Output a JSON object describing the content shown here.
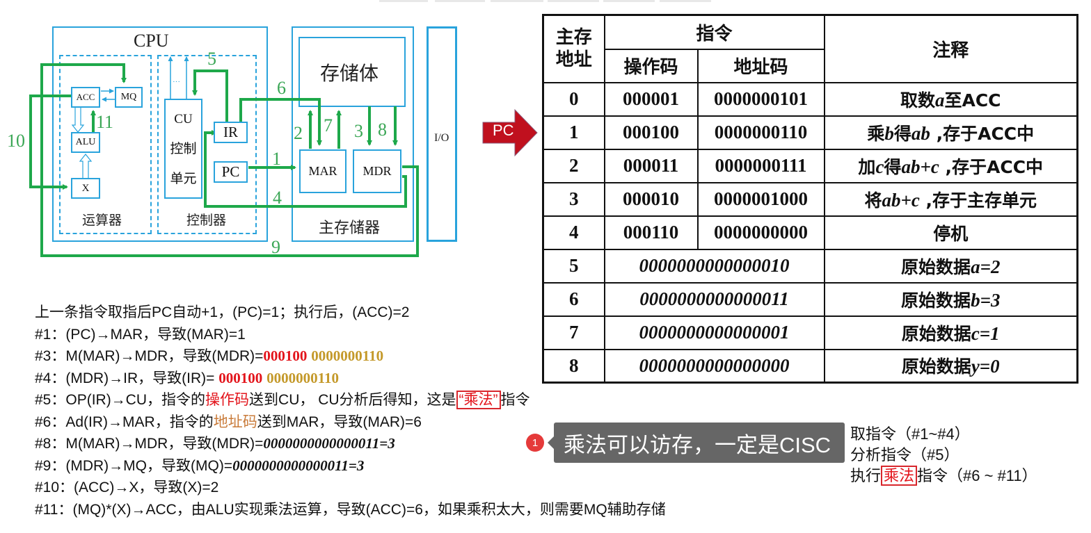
{
  "diagram": {
    "cpu_label": "CPU",
    "alu_group_label": "运算器",
    "cu_group_label": "控制器",
    "memory_label": "主存储器",
    "storage_body_label": "存储体",
    "io_label": "I/O",
    "registers": {
      "acc": "ACC",
      "mq": "MQ",
      "alu": "ALU",
      "x": "X",
      "cu_line1": "CU",
      "cu_line2": "控制",
      "cu_line3": "单元",
      "ir": "IR",
      "pc": "PC",
      "mar": "MAR",
      "mdr": "MDR",
      "cu_dots": "···"
    },
    "step_numbers": [
      "1",
      "2",
      "3",
      "4",
      "5",
      "6",
      "7",
      "8",
      "9",
      "10",
      "11"
    ],
    "colors": {
      "bus": "#1ea84a",
      "block": "#29a3dc"
    }
  },
  "pc_pointer": {
    "label": "PC",
    "color": "#c0101e",
    "points_to_address": "1"
  },
  "memory_table": {
    "headers": {
      "address": "主存地址",
      "address_line1": "主存",
      "address_line2": "地址",
      "instruction": "指令",
      "opcode": "操作码",
      "addr_code": "地址码",
      "comment": "注释"
    },
    "rows": [
      {
        "address": "0",
        "opcode": "000001",
        "addr_code": "0000000101",
        "comment_parts": [
          "取数",
          "a",
          "至ACC"
        ]
      },
      {
        "address": "1",
        "opcode": "000100",
        "addr_code": "0000000110",
        "comment_parts": [
          "乘",
          "b",
          "得",
          "ab",
          " ,存于ACC中"
        ]
      },
      {
        "address": "2",
        "opcode": "000011",
        "addr_code": "0000000111",
        "comment_parts": [
          "加",
          "c",
          "得",
          "ab+c",
          "  ,存于ACC中"
        ]
      },
      {
        "address": "3",
        "opcode": "000010",
        "addr_code": "0000001000",
        "comment_parts": [
          "将",
          "ab+c",
          " ,存于主存单元"
        ]
      },
      {
        "address": "4",
        "opcode": "000110",
        "addr_code": "0000000000",
        "comment_parts": [
          "停机"
        ]
      },
      {
        "address": "5",
        "data": "0000000000000010",
        "comment_parts": [
          "原始数据",
          "a=2"
        ]
      },
      {
        "address": "6",
        "data": "0000000000000011",
        "comment_parts": [
          "原始数据",
          "b=3"
        ]
      },
      {
        "address": "7",
        "data": "0000000000000001",
        "comment_parts": [
          "原始数据",
          "c=1"
        ]
      },
      {
        "address": "8",
        "data": "0000000000000000",
        "comment_parts": [
          "原始数据",
          "y=0"
        ]
      }
    ],
    "colors": {
      "opcode": "#e3141b",
      "addr_code": "#c4992a"
    }
  },
  "steps": {
    "intro": "上一条指令取指后PC自动+1，(PC)=1；执行后，(ACC)=2",
    "s1": "#1：(PC)→MAR，导致(MAR)=1",
    "s3_prefix": "#3：M(MAR)→MDR，导致(MDR)=",
    "s3_op": "000100",
    "s3_ad": "0000000110",
    "s4_prefix": "#4：(MDR)→IR，导致(IR)= ",
    "s4_op": "000100",
    "s4_ad": "0000000110",
    "s5_a": "#5：OP(IR)→CU，指令的",
    "s5_b": "操作码",
    "s5_c": "送到CU， CU分析后得知，这是",
    "s5_d": "“乘法”",
    "s5_e": "指令",
    "s6_a": "#6：Ad(IR)→MAR，指令的",
    "s6_b": "地址码",
    "s6_c": "送到MAR，导致(MAR)=6",
    "s8_prefix": "#8：M(MAR)→MDR，导致(MDR)=",
    "s8_val": "0000000000000011=3",
    "s9_prefix": "#9：(MDR)→MQ，导致(MQ)=",
    "s9_val": "0000000000000011=3",
    "s10": "#10：(ACC)→X，导致(X)=2",
    "s11": "#11：(MQ)*(X)→ACC，由ALU实现乘法运算，导致(ACC)=6，如果乘积太大，则需要MQ辅助存储"
  },
  "comment": {
    "badge": "1",
    "text": "乘法可以访存，一定是CISC"
  },
  "phases": {
    "fetch": "取指令（#1~#4）",
    "decode": "分析指令（#5）",
    "exec_a": "执行",
    "exec_b": "乘法",
    "exec_c": "指令（#6 ~ #11）"
  }
}
